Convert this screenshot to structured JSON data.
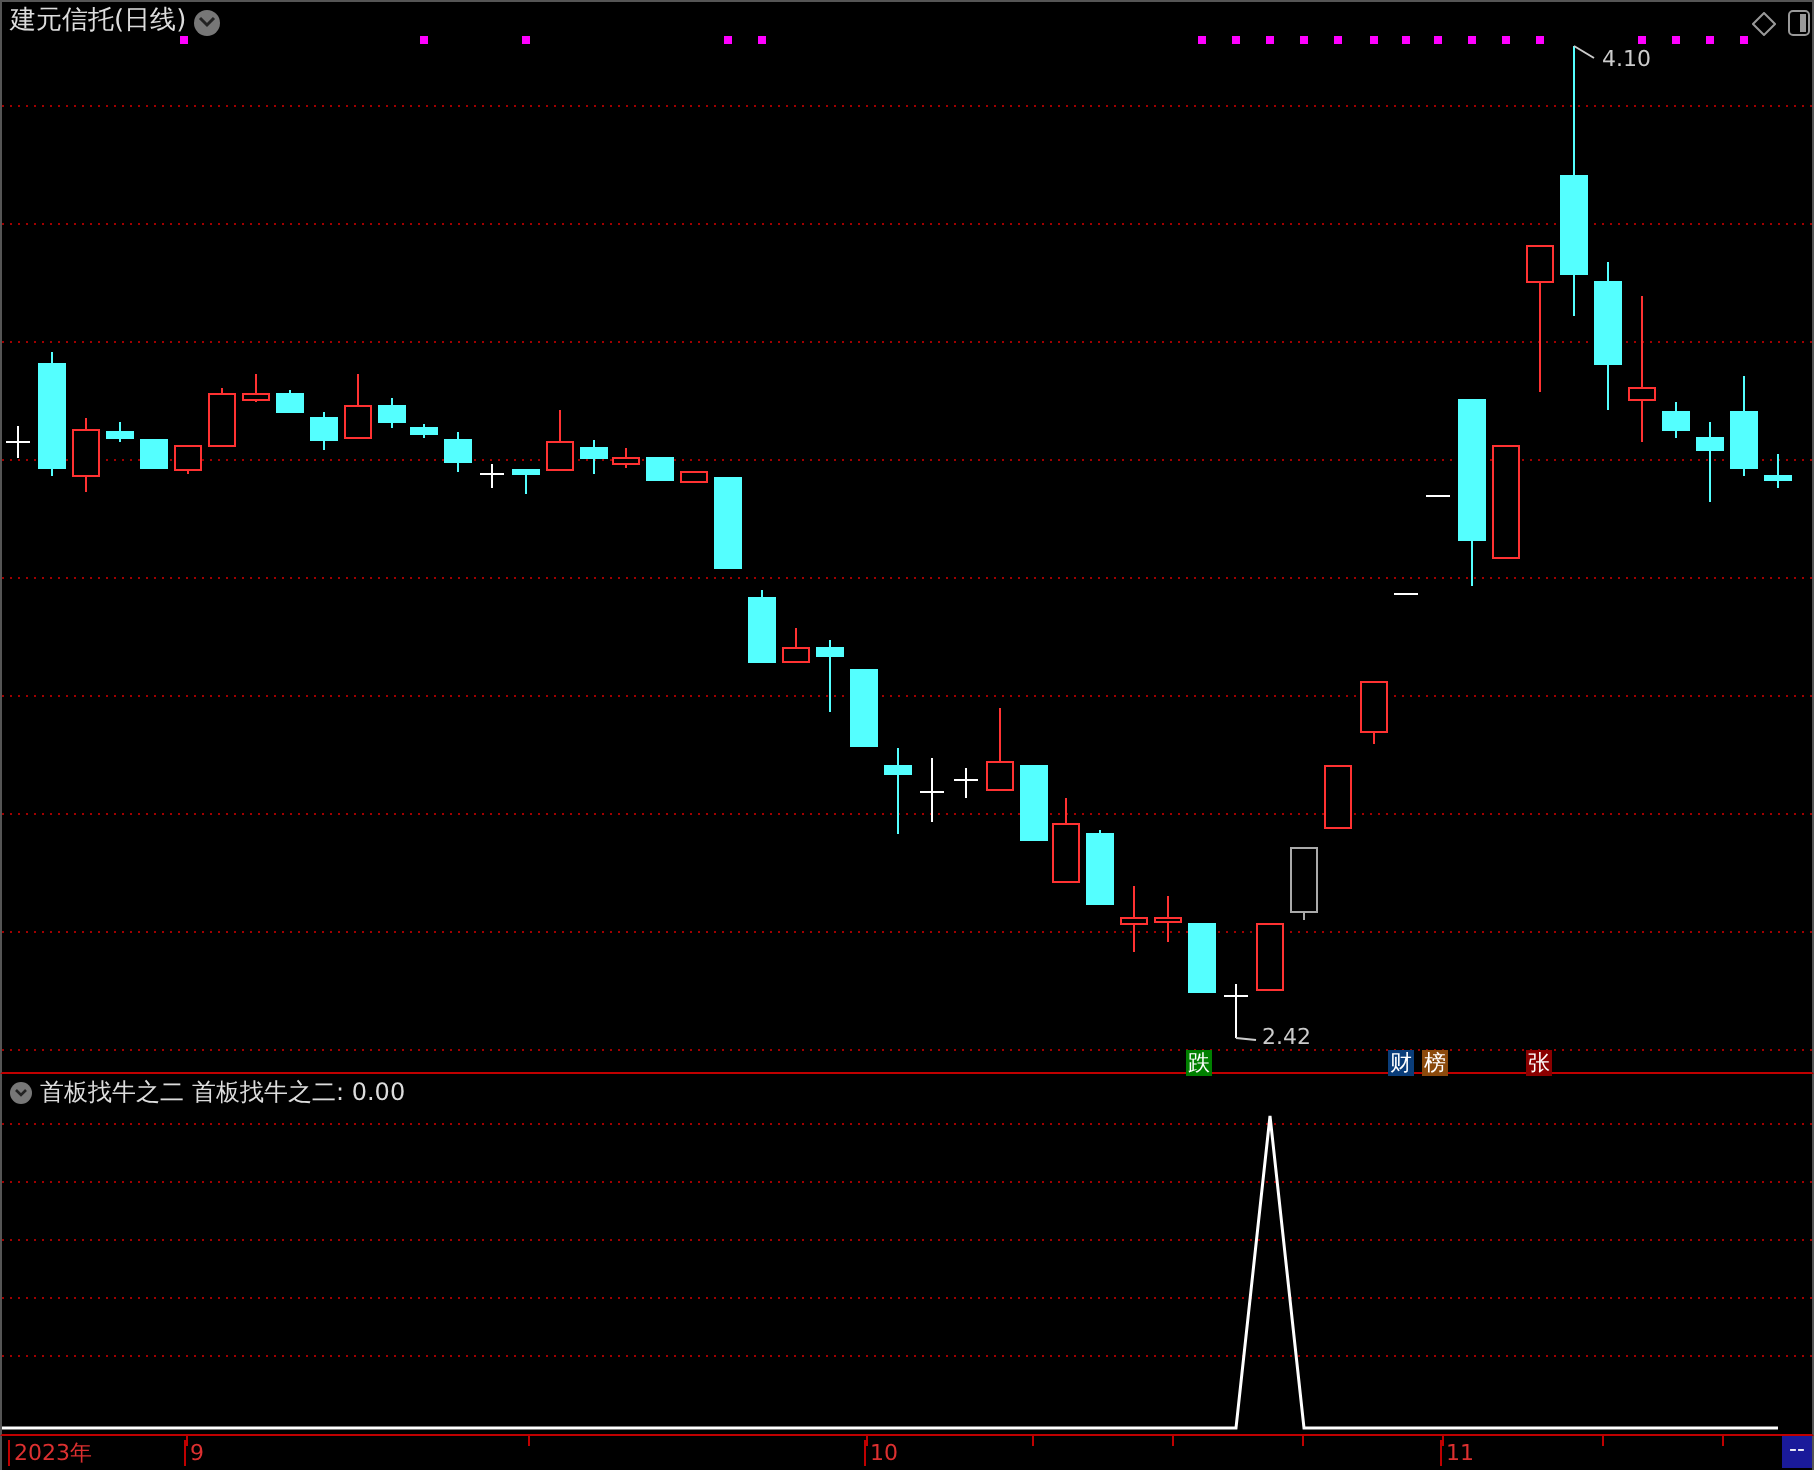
{
  "title": "建元信托(日线)",
  "high_label": "4.10",
  "low_label": "2.42",
  "signals": [
    {
      "text": "跌",
      "color": "#008000"
    },
    {
      "text": "财",
      "color": "#0a3d7a"
    },
    {
      "text": "榜",
      "color": "#8b4a0c"
    },
    {
      "text": "张",
      "color": "#8b0000"
    }
  ],
  "indicator": {
    "name": "首板找牛之二",
    "reading": "首板找牛之二: 0.00"
  },
  "x_axis": [
    "2023年",
    "9",
    "10",
    "11"
  ],
  "corner_label": "--"
}
